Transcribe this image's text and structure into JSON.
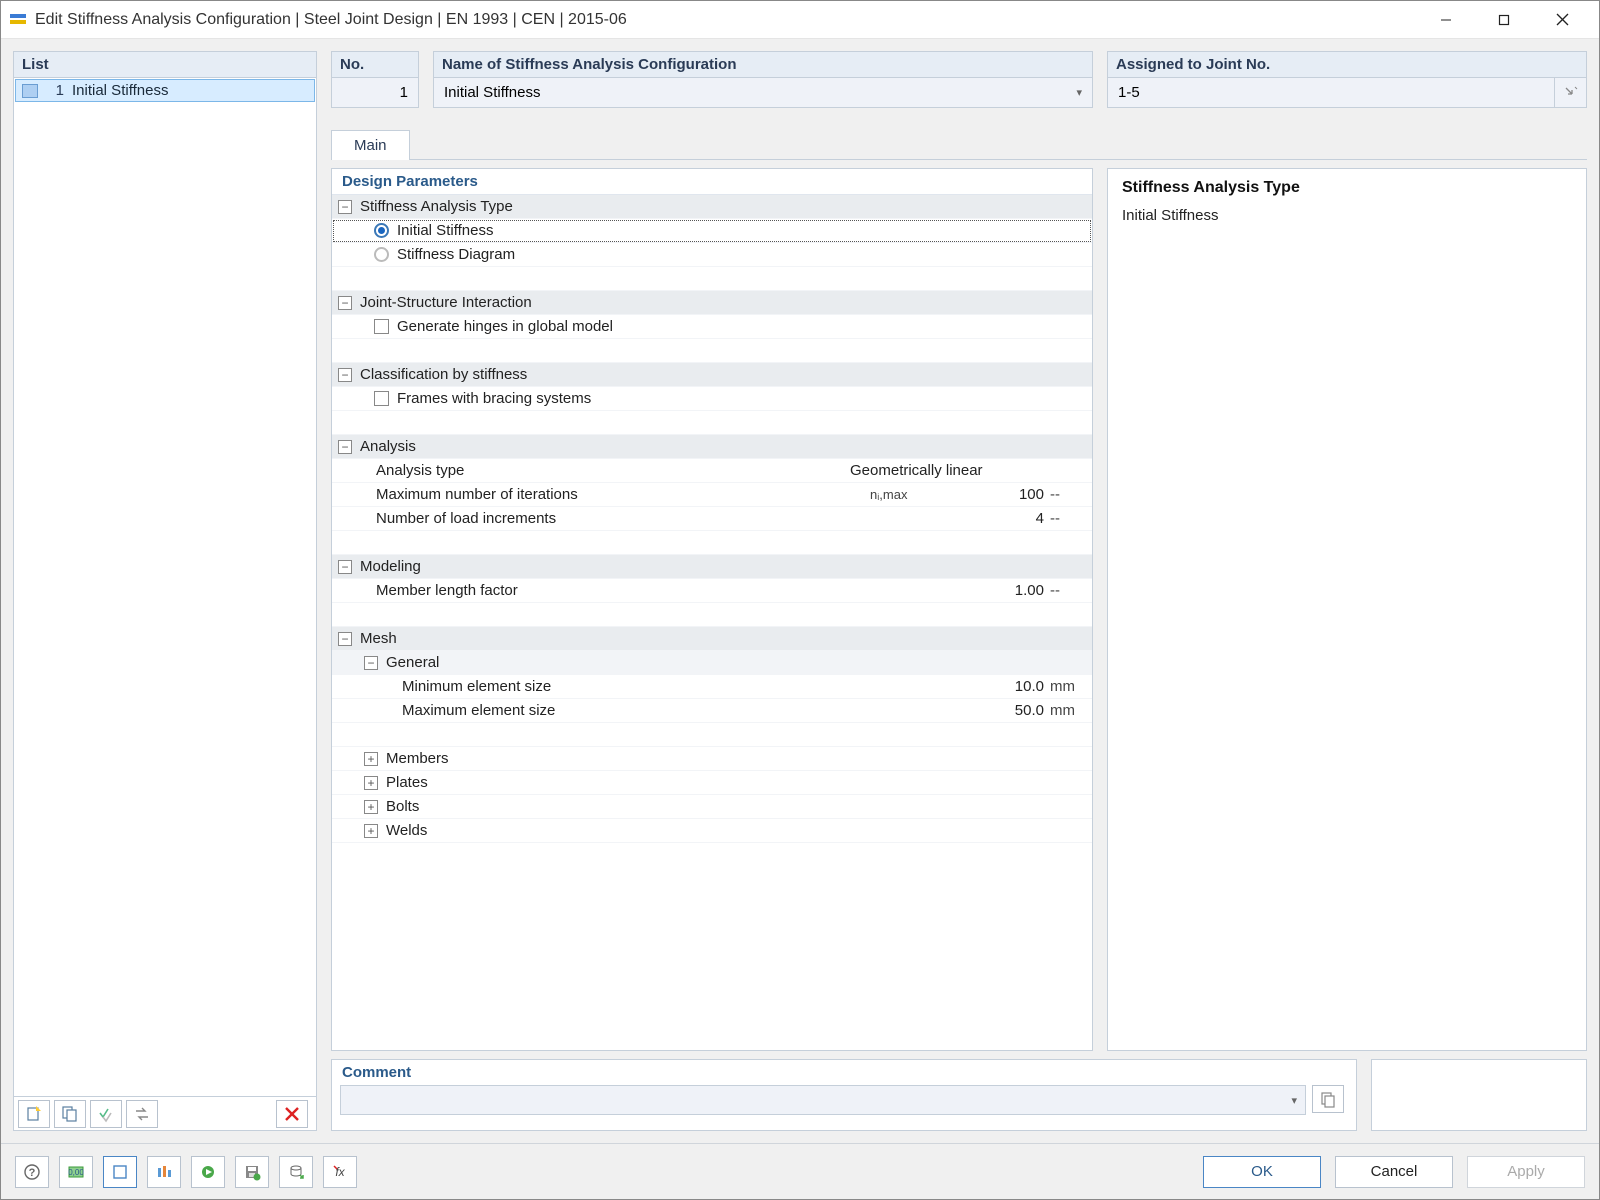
{
  "window": {
    "title": "Edit Stiffness Analysis Configuration | Steel Joint Design | EN 1993 | CEN | 2015-06"
  },
  "sidebar": {
    "header": "List",
    "items": [
      {
        "num": "1",
        "label": "Initial Stiffness"
      }
    ]
  },
  "fields": {
    "no_label": "No.",
    "no_value": "1",
    "name_label": "Name of Stiffness Analysis Configuration",
    "name_value": "Initial Stiffness",
    "joint_label": "Assigned to Joint No.",
    "joint_value": "1-5"
  },
  "tabs": {
    "main": "Main"
  },
  "section_header": "Design Parameters",
  "tree": {
    "stiffness_type": {
      "group": "Stiffness Analysis Type",
      "opt1": "Initial Stiffness",
      "opt2": "Stiffness Diagram"
    },
    "joint_inter": {
      "group": "Joint-Structure Interaction",
      "opt": "Generate hinges in global model"
    },
    "classification": {
      "group": "Classification by stiffness",
      "opt": "Frames with bracing systems"
    },
    "analysis": {
      "group": "Analysis",
      "type_label": "Analysis type",
      "type_value": "Geometrically linear",
      "maxiter_label": "Maximum number of iterations",
      "maxiter_symbol": "nᵢ,max",
      "maxiter_value": "100",
      "maxiter_unit": "--",
      "increments_label": "Number of load increments",
      "increments_value": "4",
      "increments_unit": "--"
    },
    "modeling": {
      "group": "Modeling",
      "factor_label": "Member length factor",
      "factor_value": "1.00",
      "factor_unit": "--"
    },
    "mesh": {
      "group": "Mesh",
      "general": "General",
      "min_label": "Minimum element size",
      "min_value": "10.0",
      "min_unit": "mm",
      "max_label": "Maximum element size",
      "max_value": "50.0",
      "max_unit": "mm",
      "members": "Members",
      "plates": "Plates",
      "bolts": "Bolts",
      "welds": "Welds"
    }
  },
  "right_panel": {
    "title": "Stiffness Analysis Type",
    "body": "Initial Stiffness"
  },
  "comment": {
    "label": "Comment"
  },
  "buttons": {
    "ok": "OK",
    "cancel": "Cancel",
    "apply": "Apply"
  }
}
